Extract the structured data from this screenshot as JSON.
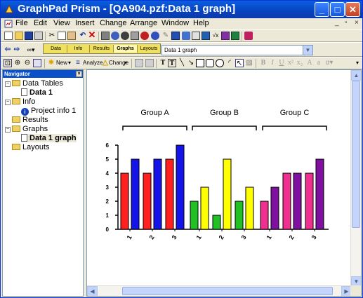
{
  "window": {
    "title": "GraphPad Prism - [QA904.pzf:Data 1 graph]",
    "minimize": "_",
    "maximize": "□",
    "close": "✕"
  },
  "menu": {
    "items": [
      "File",
      "Edit",
      "View",
      "Insert",
      "Change",
      "Arrange",
      "Window",
      "Help"
    ],
    "mdi_buttons": [
      "_",
      "▫",
      "×"
    ]
  },
  "toolbar2": {
    "tabs": [
      "Data",
      "Info",
      "Results",
      "Graphs",
      "Layouts"
    ],
    "active_tab": "Graphs",
    "sheet_selector": "Data 1 graph"
  },
  "toolbar3": {
    "new_label": "New",
    "analyze_label": "Analyze",
    "change_label": "Change"
  },
  "navigator": {
    "title": "Navigator",
    "items": [
      {
        "label": "Data Tables",
        "kind": "folder",
        "expand": "−"
      },
      {
        "label": "Data 1",
        "kind": "sheet"
      },
      {
        "label": "Info",
        "kind": "folder",
        "expand": "−"
      },
      {
        "label": "Project info 1",
        "kind": "info"
      },
      {
        "label": "Results",
        "kind": "folder"
      },
      {
        "label": "Graphs",
        "kind": "folder",
        "expand": "−"
      },
      {
        "label": "Data 1 graph",
        "kind": "sheet",
        "selected": true
      },
      {
        "label": "Layouts",
        "kind": "folder"
      }
    ]
  },
  "chart_data": {
    "type": "bar",
    "title": "",
    "ylim": [
      0,
      6
    ],
    "yticks": [
      0,
      1,
      2,
      3,
      4,
      5,
      6
    ],
    "groups": [
      {
        "name": "Group A",
        "categories": [
          "1",
          "2",
          "3"
        ],
        "bars": [
          [
            4,
            5
          ],
          [
            4,
            5
          ],
          [
            5,
            6
          ]
        ],
        "colors": [
          "#ff2020",
          "#1414e8"
        ]
      },
      {
        "name": "Group B",
        "categories": [
          "1",
          "2",
          "3"
        ],
        "bars": [
          [
            2,
            3
          ],
          [
            1,
            5
          ],
          [
            2,
            3
          ]
        ],
        "colors": [
          "#22c022",
          "#ffff00"
        ]
      },
      {
        "name": "Group C",
        "categories": [
          "1",
          "2",
          "3"
        ],
        "bars": [
          [
            2,
            3
          ],
          [
            4,
            4
          ],
          [
            4,
            5
          ]
        ],
        "colors": [
          "#f03090",
          "#8010a0"
        ]
      }
    ]
  }
}
